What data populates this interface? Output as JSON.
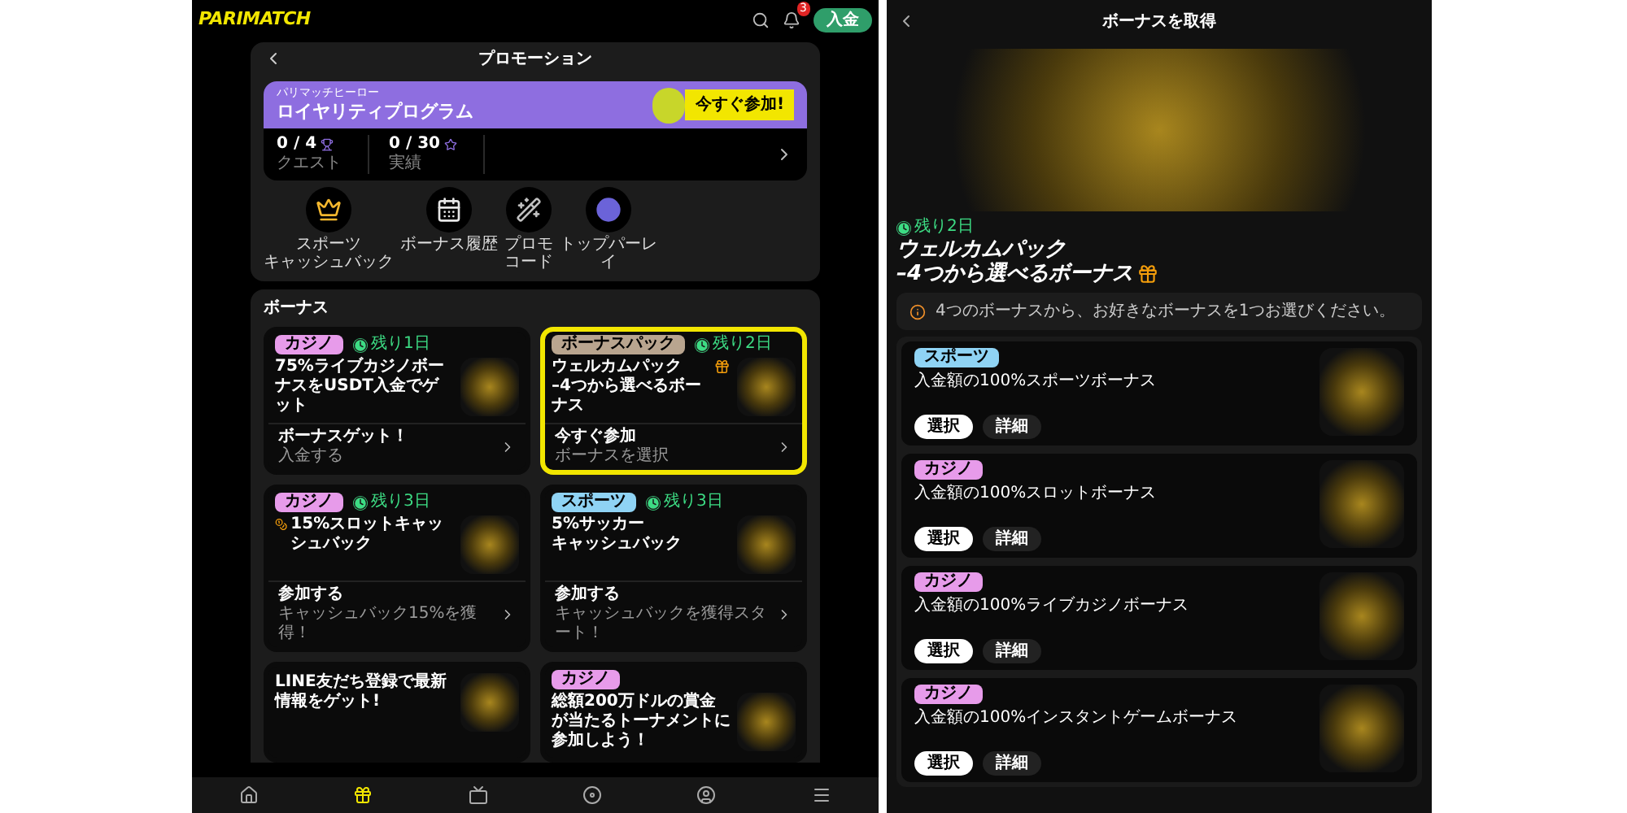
{
  "header": {
    "logo": "PARIMATCH",
    "notification_count": "3",
    "deposit_button": "入金"
  },
  "promotions": {
    "title": "プロモーション",
    "loyalty": {
      "eyebrow": "パリマッチヒーロー",
      "title": "ロイヤリティプログラム",
      "join_button": "今すぐ参加!",
      "stats": [
        {
          "value": "0 / 4",
          "label": "クエスト",
          "kind": "quest"
        },
        {
          "value": "0 / 30",
          "label": "実績",
          "kind": "achievement"
        }
      ]
    },
    "shortcuts": [
      {
        "label": [
          "スポーツ",
          "キャッシュバック"
        ],
        "kind": "crown"
      },
      {
        "label": [
          "ボーナス履歴"
        ],
        "kind": "calendar"
      },
      {
        "label": [
          "プロモ",
          "コード"
        ],
        "kind": "wand"
      },
      {
        "label": [
          "トップパーレ",
          "イ"
        ],
        "kind": "ball"
      }
    ]
  },
  "bonus_section": {
    "title": "ボーナス",
    "cards": [
      {
        "kind": "plain",
        "tag": {
          "label": "カジノ",
          "color": "#e79bea"
        },
        "timer": "残り1日",
        "title": "75%ライブカジノボーナスをUSDT入金でゲット",
        "action": "ボーナスゲット！",
        "action_note": "入金する",
        "highlighted": false
      },
      {
        "kind": "gift",
        "tag": {
          "label": "ボーナスパック",
          "color": "#b9a58f"
        },
        "timer": "残り2日",
        "title": [
          "ウェルカムパック",
          "–4つから選べるボーナス"
        ],
        "action": "今すぐ参加",
        "action_note": "ボーナスを選択",
        "highlighted": true
      },
      {
        "kind": "coins",
        "tag": {
          "label": "カジノ",
          "color": "#e79bea"
        },
        "timer": "残り3日",
        "title": "15%スロットキャッシュバック",
        "action": "参加する",
        "action_note": "キャッシュバック15%を獲得！",
        "highlighted": false
      },
      {
        "kind": "plain",
        "tag": {
          "label": "スポーツ",
          "color": "#8fd3f4"
        },
        "timer": "残り3日",
        "title": [
          "5%サッカー",
          "キャッシュバック"
        ],
        "action": "参加する",
        "action_note": "キャッシュバックを獲得スタート！",
        "highlighted": false
      },
      {
        "kind": "plain",
        "title": "LINE友だち登録で最新情報をゲット!",
        "highlighted": false
      },
      {
        "kind": "plain",
        "tag": {
          "label": "カジノ",
          "color": "#e79bea"
        },
        "title": "総額200万ドルの賞金が当たるトーナメントに参加しよう！",
        "highlighted": false
      }
    ]
  },
  "bottom_nav": [
    {
      "kind": "home",
      "selected": false
    },
    {
      "kind": "gift",
      "selected": true
    },
    {
      "kind": "sports",
      "selected": false
    },
    {
      "kind": "casino",
      "selected": false
    },
    {
      "kind": "user",
      "selected": false
    },
    {
      "kind": "menu",
      "selected": false
    }
  ],
  "detail": {
    "title": "ボーナスを取得",
    "timer": "残り2日",
    "heading": [
      "ウェルカムパック",
      "–4つから選べるボーナス"
    ],
    "notice": "4つのボーナスから、お好きなボーナスを1つお選びください。",
    "options": [
      {
        "tag": {
          "label": "スポーツ",
          "color": "#8fd3f4"
        },
        "title": "入金額の100%スポーツボーナス",
        "select_button": "選択",
        "details_button": "詳細"
      },
      {
        "tag": {
          "label": "カジノ",
          "color": "#e79bea"
        },
        "title": "入金額の100%スロットボーナス",
        "select_button": "選択",
        "details_button": "詳細"
      },
      {
        "tag": {
          "label": "カジノ",
          "color": "#e79bea"
        },
        "title": "入金額の100%ライブカジノボーナス",
        "select_button": "選択",
        "details_button": "詳細"
      },
      {
        "tag": {
          "label": "カジノ",
          "color": "#e79bea"
        },
        "title": "入金額の100%インスタントゲームボーナス",
        "select_button": "選択",
        "details_button": "詳細"
      }
    ]
  }
}
